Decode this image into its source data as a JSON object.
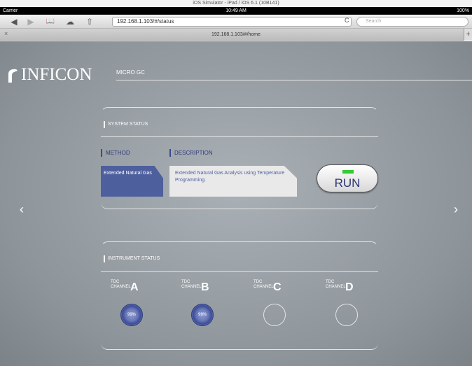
{
  "simulator_title": "iOS Simulator - iPad / iOS 6.1 (10B141)",
  "status_bar": {
    "carrier": "Carrier",
    "time": "10:49 AM",
    "battery": "100%"
  },
  "browser": {
    "url": "192.168.1.103/#/status",
    "search_placeholder": "Search",
    "tab_title": "192.168.1.103/#/home",
    "tab_close": "×",
    "tab_new": "+",
    "back_icon": "◀",
    "forward_icon": "▶",
    "bookmarks_icon": "📖",
    "cloud_icon": "☁",
    "share_icon": "⇧",
    "reload_icon": "C"
  },
  "header": {
    "brand": "INFICON",
    "product": "MICRO GC"
  },
  "system_status": {
    "title": "SYSTEM STATUS",
    "method_label": "METHOD",
    "description_label": "DESCRIPTION",
    "method_value": "Extended Natural Gas",
    "description_value": "Extended Natural Gas Analysis using Temperature Programming.",
    "run_label": "RUN"
  },
  "instrument_status": {
    "title": "INSTRUMENT STATUS",
    "channels": [
      {
        "prefix": "TDC",
        "label": "CHANNEL",
        "letter": "A",
        "value": "99%",
        "active": true
      },
      {
        "prefix": "TDC",
        "label": "CHANNEL",
        "letter": "B",
        "value": "99%",
        "active": true
      },
      {
        "prefix": "TDC",
        "label": "CHANNEL",
        "letter": "C",
        "value": "",
        "active": false
      },
      {
        "prefix": "TDC",
        "label": "CHANNEL",
        "letter": "D",
        "value": "",
        "active": false
      }
    ]
  },
  "nav": {
    "prev": "‹",
    "next": "›"
  },
  "colors": {
    "accent": "#4e5f9e",
    "led": "#33cc33",
    "background": "#9aa1a7"
  }
}
